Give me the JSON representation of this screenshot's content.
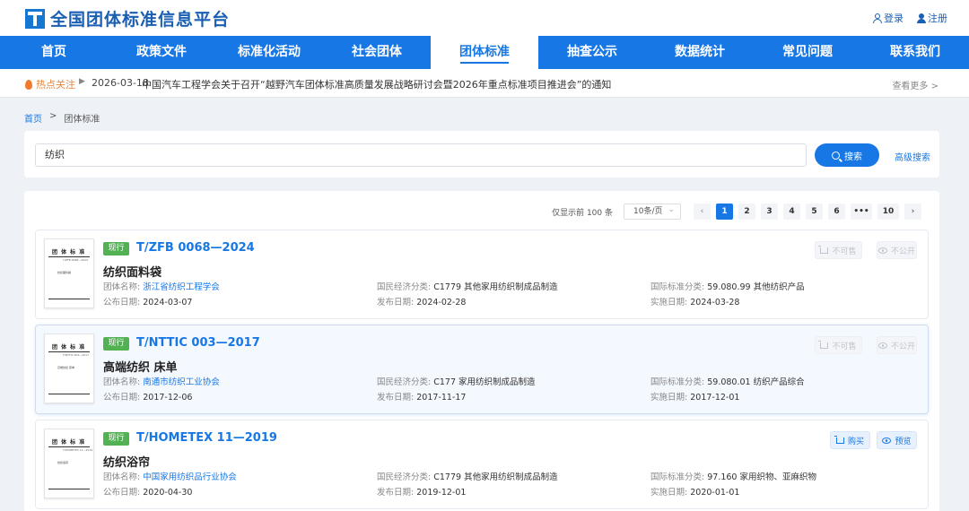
{
  "header": {
    "site_title": "全国团体标准信息平台",
    "login_label": "登录",
    "register_label": "注册"
  },
  "nav": {
    "items": [
      "首页",
      "政策文件",
      "标准化活动",
      "社会团体",
      "团体标准",
      "抽查公示",
      "数据统计",
      "常见问题",
      "联系我们"
    ],
    "active_index": 4
  },
  "hotbar": {
    "label": "热点关注",
    "date": "2026-03-18",
    "text": "中国汽车工程学会关于召开“越野汽车团体标准高质量发展战略研讨会暨2026年重点标准项目推进会”的通知",
    "more": "查看更多 >"
  },
  "breadcrumb": {
    "home": "首页",
    "sep": ">",
    "current": "团体标准"
  },
  "search": {
    "value": "纺织",
    "button": "搜索",
    "advanced": "高级搜索"
  },
  "pagination": {
    "info": "仅显示前 100 条",
    "page_size": "10条/页",
    "pages": [
      "1",
      "2",
      "3",
      "4",
      "5",
      "6",
      "•••",
      "10"
    ],
    "current": "1",
    "prev_icon": "chevron-left-icon",
    "next_icon": "chevron-right-icon"
  },
  "labels": {
    "org": "团体名称:",
    "econ": "国民经济分类:",
    "intl": "国际标准分类:",
    "publish": "公布日期:",
    "release": "发布日期:",
    "impl": "实施日期:"
  },
  "thumb": {
    "heading": "团 体 标 准"
  },
  "standards": [
    {
      "status": "现行",
      "code": "T/ZFB 0068—2024",
      "title": "纺织面料袋",
      "org": "浙江省纺织工程学会",
      "econ": "C1779 其他家用纺织制成品制造",
      "intl": "59.080.99 其他纺织产品",
      "publish_date": "2024-03-07",
      "release_date": "2024-02-28",
      "impl_date": "2024-03-28",
      "buy": "不可售",
      "view": "不公开",
      "enabled": false,
      "thumb_code": "T/ZFB 0068—2024",
      "thumb_title": "纺织面料袋"
    },
    {
      "status": "现行",
      "code": "T/NTTIC 003—2017",
      "title": "高端纺织 床单",
      "org": "南通市纺织工业协会",
      "econ": "C177 家用纺织制成品制造",
      "intl": "59.080.01 纺织产品综合",
      "publish_date": "2017-12-06",
      "release_date": "2017-11-17",
      "impl_date": "2017-12-01",
      "buy": "不可售",
      "view": "不公开",
      "enabled": false,
      "thumb_code": "T/NTTIC 003—2017",
      "thumb_title": "高端纺织 床单"
    },
    {
      "status": "现行",
      "code": "T/HOMETEX 11—2019",
      "title": "纺织浴帘",
      "org": "中国家用纺织品行业协会",
      "econ": "C1779 其他家用纺织制成品制造",
      "intl": "97.160 家用织物、亚麻织物",
      "publish_date": "2020-04-30",
      "release_date": "2019-12-01",
      "impl_date": "2020-01-01",
      "buy": "购买",
      "view": "预览",
      "enabled": true,
      "thumb_code": "T/HOMETEX 11—2019",
      "thumb_title": "纺织浴帘"
    }
  ]
}
